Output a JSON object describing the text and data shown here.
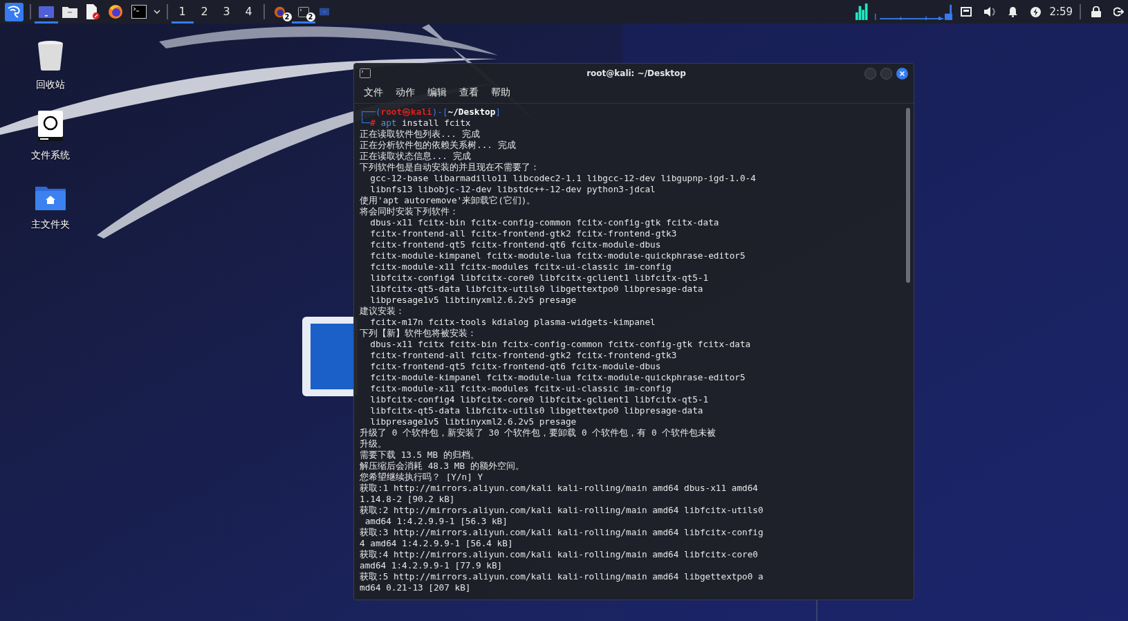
{
  "taskbar": {
    "workspaces": [
      {
        "label": "1",
        "selected": true
      },
      {
        "label": "2",
        "selected": false
      },
      {
        "label": "3",
        "selected": false
      },
      {
        "label": "4",
        "selected": false
      }
    ],
    "windows": [
      {
        "kind": "firefox",
        "count": "2",
        "selected": false
      },
      {
        "kind": "terminal",
        "count": "2",
        "selected": true
      },
      {
        "kind": "folder",
        "selected": false
      }
    ],
    "clock": "2:59"
  },
  "desktop_icons": [
    {
      "kind": "trash",
      "label": "回收站"
    },
    {
      "kind": "drive",
      "label": "文件系统"
    },
    {
      "kind": "home",
      "label": "主文件夹"
    }
  ],
  "terminal": {
    "title": "root@kali: ~/Desktop",
    "menu": [
      "文件",
      "动作",
      "编辑",
      "查看",
      "帮助"
    ],
    "prompt": [
      [
        {
          "kind": "frame",
          "text": "┌──("
        },
        {
          "kind": "user",
          "text": "root㉿kali"
        },
        {
          "kind": "frame",
          "text": ")-["
        },
        {
          "kind": "path",
          "text": "~/Desktop"
        },
        {
          "kind": "frame",
          "text": "]"
        }
      ],
      [
        {
          "kind": "frame",
          "text": "└─"
        },
        {
          "kind": "user",
          "text": "#"
        },
        {
          "kind": "command",
          "text": " apt"
        },
        {
          "kind": "plain",
          "text": " install fcitx"
        }
      ]
    ],
    "output": [
      "正在读取软件包列表... 完成",
      "正在分析软件包的依赖关系树... 完成",
      "正在读取状态信息... 完成",
      "下列软件包是自动安装的并且现在不需要了：",
      "  gcc-12-base libarmadillo11 libcodec2-1.1 libgcc-12-dev libgupnp-igd-1.0-4",
      "  libnfs13 libobjc-12-dev libstdc++-12-dev python3-jdcal",
      "使用'apt autoremove'来卸载它(它们)。",
      "将会同时安装下列软件：",
      "  dbus-x11 fcitx-bin fcitx-config-common fcitx-config-gtk fcitx-data",
      "  fcitx-frontend-all fcitx-frontend-gtk2 fcitx-frontend-gtk3",
      "  fcitx-frontend-qt5 fcitx-frontend-qt6 fcitx-module-dbus",
      "  fcitx-module-kimpanel fcitx-module-lua fcitx-module-quickphrase-editor5",
      "  fcitx-module-x11 fcitx-modules fcitx-ui-classic im-config",
      "  libfcitx-config4 libfcitx-core0 libfcitx-gclient1 libfcitx-qt5-1",
      "  libfcitx-qt5-data libfcitx-utils0 libgettextpo0 libpresage-data",
      "  libpresage1v5 libtinyxml2.6.2v5 presage",
      "建议安装：",
      "  fcitx-m17n fcitx-tools kdialog plasma-widgets-kimpanel",
      "下列【新】软件包将被安装：",
      "  dbus-x11 fcitx fcitx-bin fcitx-config-common fcitx-config-gtk fcitx-data",
      "  fcitx-frontend-all fcitx-frontend-gtk2 fcitx-frontend-gtk3",
      "  fcitx-frontend-qt5 fcitx-frontend-qt6 fcitx-module-dbus",
      "  fcitx-module-kimpanel fcitx-module-lua fcitx-module-quickphrase-editor5",
      "  fcitx-module-x11 fcitx-modules fcitx-ui-classic im-config",
      "  libfcitx-config4 libfcitx-core0 libfcitx-gclient1 libfcitx-qt5-1",
      "  libfcitx-qt5-data libfcitx-utils0 libgettextpo0 libpresage-data",
      "  libpresage1v5 libtinyxml2.6.2v5 presage",
      "升级了 0 个软件包，新安装了 30 个软件包，要卸载 0 个软件包，有 0 个软件包未被",
      "升级。",
      "需要下载 13.5 MB 的归档。",
      "解压缩后会消耗 48.3 MB 的额外空间。",
      "您希望继续执行吗？ [Y/n] Y",
      "获取:1 http://mirrors.aliyun.com/kali kali-rolling/main amd64 dbus-x11 amd64",
      "1.14.8-2 [90.2 kB]",
      "获取:2 http://mirrors.aliyun.com/kali kali-rolling/main amd64 libfcitx-utils0",
      " amd64 1:4.2.9.9-1 [56.3 kB]",
      "获取:3 http://mirrors.aliyun.com/kali kali-rolling/main amd64 libfcitx-config",
      "4 amd64 1:4.2.9.9-1 [56.4 kB]",
      "获取:4 http://mirrors.aliyun.com/kali kali-rolling/main amd64 libfcitx-core0",
      "amd64 1:4.2.9.9-1 [77.9 kB]",
      "获取:5 http://mirrors.aliyun.com/kali kali-rolling/main amd64 libgettextpo0 a",
      "md64 0.21-13 [207 kB]"
    ]
  }
}
